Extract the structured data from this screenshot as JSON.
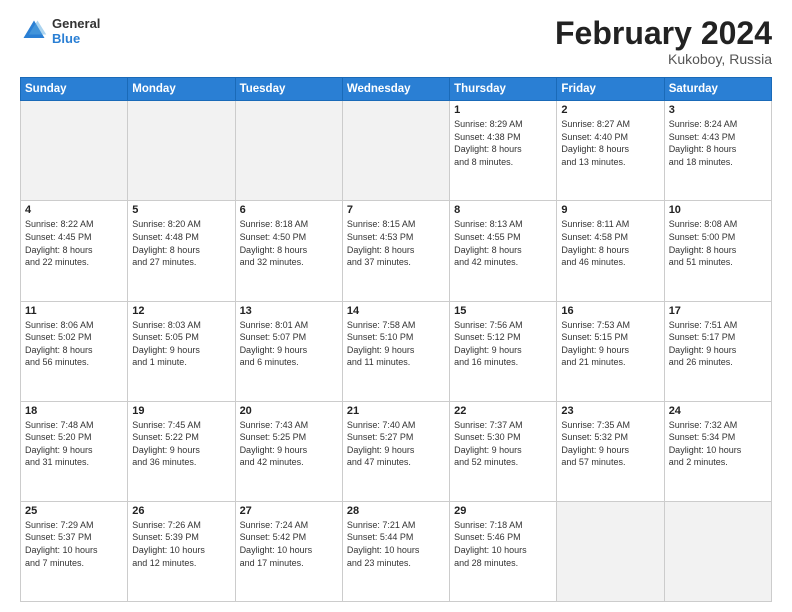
{
  "logo": {
    "general": "General",
    "blue": "Blue"
  },
  "title": "February 2024",
  "subtitle": "Kukoboy, Russia",
  "weekdays": [
    "Sunday",
    "Monday",
    "Tuesday",
    "Wednesday",
    "Thursday",
    "Friday",
    "Saturday"
  ],
  "weeks": [
    [
      {
        "day": "",
        "info": ""
      },
      {
        "day": "",
        "info": ""
      },
      {
        "day": "",
        "info": ""
      },
      {
        "day": "",
        "info": ""
      },
      {
        "day": "1",
        "info": "Sunrise: 8:29 AM\nSunset: 4:38 PM\nDaylight: 8 hours\nand 8 minutes."
      },
      {
        "day": "2",
        "info": "Sunrise: 8:27 AM\nSunset: 4:40 PM\nDaylight: 8 hours\nand 13 minutes."
      },
      {
        "day": "3",
        "info": "Sunrise: 8:24 AM\nSunset: 4:43 PM\nDaylight: 8 hours\nand 18 minutes."
      }
    ],
    [
      {
        "day": "4",
        "info": "Sunrise: 8:22 AM\nSunset: 4:45 PM\nDaylight: 8 hours\nand 22 minutes."
      },
      {
        "day": "5",
        "info": "Sunrise: 8:20 AM\nSunset: 4:48 PM\nDaylight: 8 hours\nand 27 minutes."
      },
      {
        "day": "6",
        "info": "Sunrise: 8:18 AM\nSunset: 4:50 PM\nDaylight: 8 hours\nand 32 minutes."
      },
      {
        "day": "7",
        "info": "Sunrise: 8:15 AM\nSunset: 4:53 PM\nDaylight: 8 hours\nand 37 minutes."
      },
      {
        "day": "8",
        "info": "Sunrise: 8:13 AM\nSunset: 4:55 PM\nDaylight: 8 hours\nand 42 minutes."
      },
      {
        "day": "9",
        "info": "Sunrise: 8:11 AM\nSunset: 4:58 PM\nDaylight: 8 hours\nand 46 minutes."
      },
      {
        "day": "10",
        "info": "Sunrise: 8:08 AM\nSunset: 5:00 PM\nDaylight: 8 hours\nand 51 minutes."
      }
    ],
    [
      {
        "day": "11",
        "info": "Sunrise: 8:06 AM\nSunset: 5:02 PM\nDaylight: 8 hours\nand 56 minutes."
      },
      {
        "day": "12",
        "info": "Sunrise: 8:03 AM\nSunset: 5:05 PM\nDaylight: 9 hours\nand 1 minute."
      },
      {
        "day": "13",
        "info": "Sunrise: 8:01 AM\nSunset: 5:07 PM\nDaylight: 9 hours\nand 6 minutes."
      },
      {
        "day": "14",
        "info": "Sunrise: 7:58 AM\nSunset: 5:10 PM\nDaylight: 9 hours\nand 11 minutes."
      },
      {
        "day": "15",
        "info": "Sunrise: 7:56 AM\nSunset: 5:12 PM\nDaylight: 9 hours\nand 16 minutes."
      },
      {
        "day": "16",
        "info": "Sunrise: 7:53 AM\nSunset: 5:15 PM\nDaylight: 9 hours\nand 21 minutes."
      },
      {
        "day": "17",
        "info": "Sunrise: 7:51 AM\nSunset: 5:17 PM\nDaylight: 9 hours\nand 26 minutes."
      }
    ],
    [
      {
        "day": "18",
        "info": "Sunrise: 7:48 AM\nSunset: 5:20 PM\nDaylight: 9 hours\nand 31 minutes."
      },
      {
        "day": "19",
        "info": "Sunrise: 7:45 AM\nSunset: 5:22 PM\nDaylight: 9 hours\nand 36 minutes."
      },
      {
        "day": "20",
        "info": "Sunrise: 7:43 AM\nSunset: 5:25 PM\nDaylight: 9 hours\nand 42 minutes."
      },
      {
        "day": "21",
        "info": "Sunrise: 7:40 AM\nSunset: 5:27 PM\nDaylight: 9 hours\nand 47 minutes."
      },
      {
        "day": "22",
        "info": "Sunrise: 7:37 AM\nSunset: 5:30 PM\nDaylight: 9 hours\nand 52 minutes."
      },
      {
        "day": "23",
        "info": "Sunrise: 7:35 AM\nSunset: 5:32 PM\nDaylight: 9 hours\nand 57 minutes."
      },
      {
        "day": "24",
        "info": "Sunrise: 7:32 AM\nSunset: 5:34 PM\nDaylight: 10 hours\nand 2 minutes."
      }
    ],
    [
      {
        "day": "25",
        "info": "Sunrise: 7:29 AM\nSunset: 5:37 PM\nDaylight: 10 hours\nand 7 minutes."
      },
      {
        "day": "26",
        "info": "Sunrise: 7:26 AM\nSunset: 5:39 PM\nDaylight: 10 hours\nand 12 minutes."
      },
      {
        "day": "27",
        "info": "Sunrise: 7:24 AM\nSunset: 5:42 PM\nDaylight: 10 hours\nand 17 minutes."
      },
      {
        "day": "28",
        "info": "Sunrise: 7:21 AM\nSunset: 5:44 PM\nDaylight: 10 hours\nand 23 minutes."
      },
      {
        "day": "29",
        "info": "Sunrise: 7:18 AM\nSunset: 5:46 PM\nDaylight: 10 hours\nand 28 minutes."
      },
      {
        "day": "",
        "info": ""
      },
      {
        "day": "",
        "info": ""
      }
    ]
  ]
}
